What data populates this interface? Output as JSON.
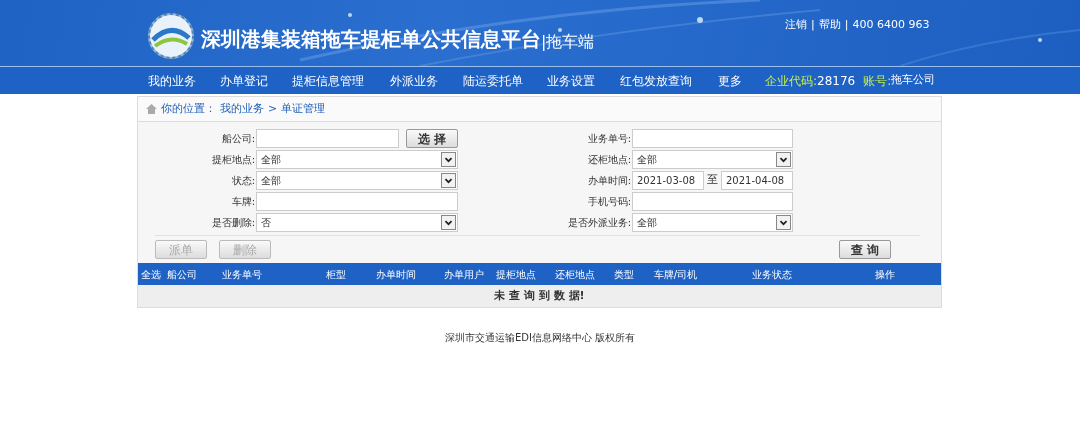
{
  "header": {
    "title": "深圳港集装箱拖车提柜单公共信息平台",
    "subtitle": "|拖车端",
    "top_links": [
      "注销",
      "帮助"
    ],
    "separator": "|",
    "hotline": "400 6400 963"
  },
  "nav": {
    "items": [
      "我的业务",
      "办单登记",
      "提柜信息管理",
      "外派业务",
      "陆运委托单",
      "业务设置",
      "红包发放查询",
      "更多"
    ],
    "company_code_label": "企业代码:",
    "company_code": "28176",
    "account_label": "账号:",
    "account": "拖车公司"
  },
  "breadcrumb": [
    "你的位置：",
    "我的业务",
    ">",
    "单证管理"
  ],
  "form": {
    "left": [
      {
        "kind": "text",
        "label": "船公司:",
        "button": "选 择"
      },
      {
        "kind": "select",
        "label": "提柜地点:",
        "value": "全部"
      },
      {
        "kind": "select",
        "label": "状态:",
        "value": "全部"
      },
      {
        "kind": "text",
        "label": "车牌:"
      },
      {
        "kind": "select",
        "label": "是否删除:",
        "value": "否"
      }
    ],
    "right": [
      {
        "kind": "text",
        "label": "业务单号:"
      },
      {
        "kind": "select",
        "label": "还柜地点:",
        "value": "全部"
      },
      {
        "kind": "range",
        "label": "办单时间:",
        "from": "2021-03-08",
        "sep": "至",
        "to": "2021-04-08"
      },
      {
        "kind": "text",
        "label": "手机号码:"
      },
      {
        "kind": "select",
        "label": "是否外派业务:",
        "value": "全部"
      }
    ]
  },
  "actions": [
    {
      "label": "派单",
      "disabled": true
    },
    {
      "label": "删除",
      "disabled": true
    }
  ],
  "search_button": "查 询",
  "table": {
    "columns": [
      "全选",
      "船公司",
      "业务单号",
      "柜型",
      "办单时间",
      "办单用户",
      "提柜地点",
      "还柜地点",
      "类型",
      "车牌/司机",
      "业务状态",
      "操作"
    ],
    "empty_message": "未 查 询 到 数 据!"
  },
  "footer": "深圳市交通运输EDI信息网络中心 版权所有"
}
